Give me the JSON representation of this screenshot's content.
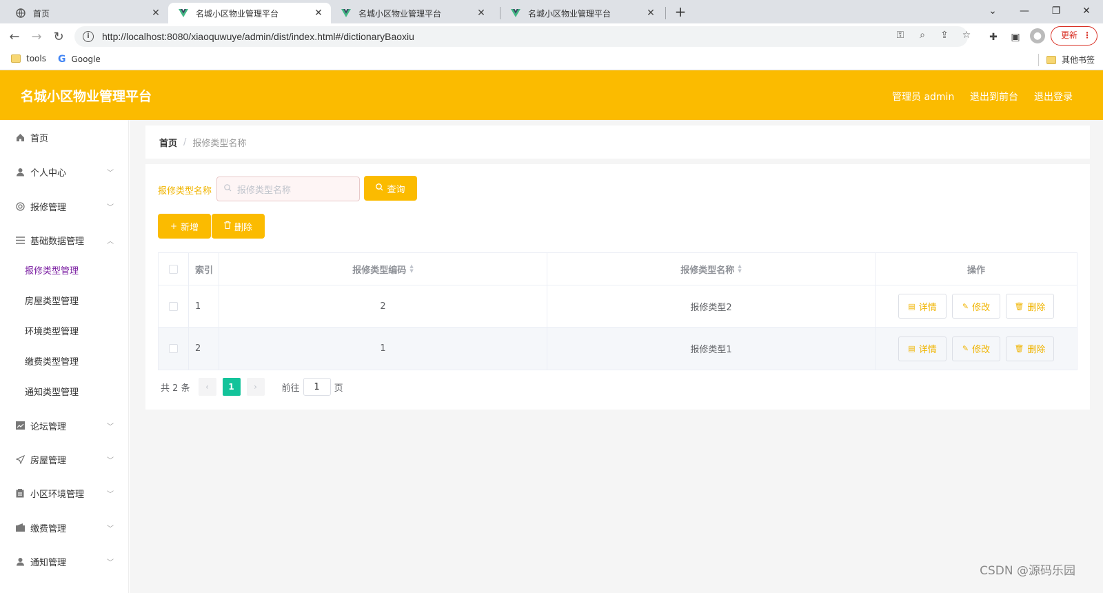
{
  "browser": {
    "tabs": [
      {
        "title": "首页",
        "icon": "globe-icon"
      },
      {
        "title": "名城小区物业管理平台",
        "icon": "vue-logo-icon"
      },
      {
        "title": "名城小区物业管理平台",
        "icon": "vue-logo-icon"
      },
      {
        "title": "名城小区物业管理平台",
        "icon": "vue-logo-icon"
      }
    ],
    "url": "http://localhost:8080/xiaoquwuye/admin/dist/index.html#/dictionaryBaoxiu",
    "update_label": "更新",
    "bookmarks": [
      {
        "label": "tools"
      },
      {
        "label": "Google"
      }
    ],
    "other_bookmarks": "其他书签"
  },
  "header": {
    "title": "名城小区物业管理平台",
    "user": "管理员 admin",
    "to_front": "退出到前台",
    "logout": "退出登录"
  },
  "sidebar": {
    "items": [
      {
        "label": "首页",
        "icon": "home-icon"
      },
      {
        "label": "个人中心",
        "icon": "user-icon"
      },
      {
        "label": "报修管理",
        "icon": "circle-icon"
      },
      {
        "label": "基础数据管理",
        "icon": "menu-icon"
      },
      {
        "label": "论坛管理",
        "icon": "chart-icon"
      },
      {
        "label": "房屋管理",
        "icon": "send-icon"
      },
      {
        "label": "小区环境管理",
        "icon": "clipboard-icon"
      },
      {
        "label": "缴费管理",
        "icon": "wallet-icon"
      },
      {
        "label": "通知管理",
        "icon": "user-icon"
      }
    ],
    "sub_items": [
      {
        "label": "报修类型管理"
      },
      {
        "label": "房屋类型管理"
      },
      {
        "label": "环境类型管理"
      },
      {
        "label": "缴费类型管理"
      },
      {
        "label": "通知类型管理"
      }
    ]
  },
  "breadcrumb": {
    "home": "首页",
    "current": "报修类型名称"
  },
  "search": {
    "label": "报修类型名称",
    "placeholder": "报修类型名称",
    "query_label": "查询"
  },
  "actions": {
    "add_label": "新增",
    "delete_label": "删除"
  },
  "table": {
    "headers": {
      "index": "索引",
      "code": "报修类型编码",
      "name": "报修类型名称",
      "ops": "操作"
    },
    "rows": [
      {
        "index": "1",
        "code": "2",
        "name": "报修类型2"
      },
      {
        "index": "2",
        "code": "1",
        "name": "报修类型1"
      }
    ],
    "op_labels": {
      "detail": "详情",
      "edit": "修改",
      "delete": "删除"
    }
  },
  "pagination": {
    "total": "共 2 条",
    "current_page": "1",
    "goto_prefix": "前往",
    "goto_value": "1",
    "goto_suffix": "页"
  },
  "watermark": "CSDN @源码乐园",
  "colors": {
    "accent": "#fbbb00",
    "page_active": "#13c39a",
    "submenu_active": "#7b1fa2"
  }
}
